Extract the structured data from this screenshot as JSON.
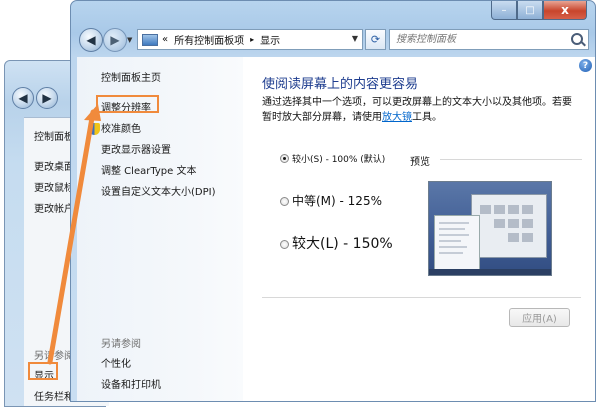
{
  "back_window": {
    "items": [
      "控制面板",
      "更改桌面",
      "更改鼠标",
      "更改帐户"
    ],
    "see_also": "另请参阅",
    "see_also_items": [
      "显示",
      "任务栏和"
    ]
  },
  "window": {
    "caption": {
      "minimize": "–",
      "maximize": "□",
      "close": "x"
    },
    "breadcrumb": {
      "root": "«",
      "parent": "所有控制面板项",
      "separator": "▸",
      "current": "显示"
    },
    "search_placeholder": "搜索控制面板",
    "sidebar": {
      "home": "控制面板主页",
      "links": [
        "调整分辨率",
        "校准颜色",
        "更改显示器设置",
        "调整 ClearType 文本",
        "设置自定义文本大小(DPI)"
      ],
      "see_also": "另请参阅",
      "see_also_items": [
        "个性化",
        "设备和打印机"
      ]
    },
    "content": {
      "title": "使阅读屏幕上的内容更容易",
      "description_before": "通过选择其中一个选项，可以更改屏幕上的文本大小以及其他项。若要暂时放大部分屏幕，请使用",
      "description_link": "放大镜",
      "description_after": "工具。",
      "options": [
        {
          "label": "较小(S) - 100% (默认)",
          "selected": true
        },
        {
          "label": "中等(M) - 125%",
          "selected": false
        },
        {
          "label": "较大(L) - 150%",
          "selected": false
        }
      ],
      "preview_label": "预览",
      "apply_button": "应用(A)"
    }
  },
  "colors": {
    "highlight": "#f08a3c",
    "link": "#0066cc",
    "title": "#1e3d8f"
  }
}
